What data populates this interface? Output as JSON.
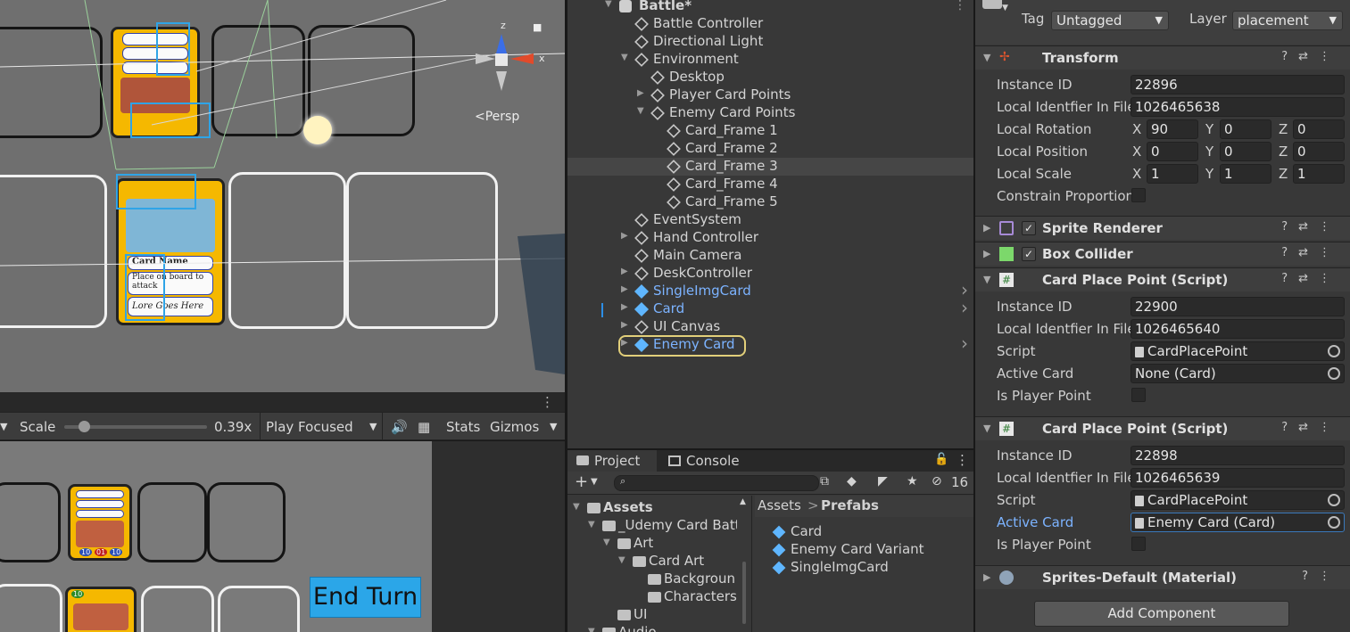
{
  "scene": {
    "persp_label": "<Persp",
    "gizmo_z": "z",
    "gizmo_x": "x",
    "card_labels": {
      "name": "Card Name",
      "desc_line1": "Place on board to",
      "desc_line2": "attack",
      "lore": "Lore Goes Here"
    }
  },
  "game_toolbar": {
    "scale_label": "Scale",
    "scale_value": 0.14,
    "scale_text": "0.39x",
    "play_mode": "Play Focused",
    "stats": "Stats",
    "gizmos": "Gizmos"
  },
  "game_view": {
    "end_turn": "End Turn",
    "card_numbers": [
      "10",
      "10",
      "01",
      "10"
    ]
  },
  "hierarchy": {
    "scene_name": "Battle*",
    "items": [
      {
        "label": "Battle Controller",
        "prefab": false
      },
      {
        "label": "Directional Light",
        "prefab": false
      },
      {
        "label": "Environment",
        "prefab": false
      },
      {
        "label": "Desktop",
        "prefab": false
      },
      {
        "label": "Player Card Points",
        "prefab": false
      },
      {
        "label": "Enemy Card Points",
        "prefab": false
      },
      {
        "label": "Card_Frame 1",
        "prefab": false
      },
      {
        "label": "Card_Frame 2",
        "prefab": false
      },
      {
        "label": "Card_Frame 3",
        "prefab": false
      },
      {
        "label": "Card_Frame 4",
        "prefab": false
      },
      {
        "label": "Card_Frame 5",
        "prefab": false
      },
      {
        "label": "EventSystem",
        "prefab": false
      },
      {
        "label": "Hand Controller",
        "prefab": false
      },
      {
        "label": "Main Camera",
        "prefab": false
      },
      {
        "label": "DeskController",
        "prefab": false
      },
      {
        "label": "SingleImgCard",
        "prefab": true
      },
      {
        "label": "Card",
        "prefab": true
      },
      {
        "label": "UI Canvas",
        "prefab": false
      },
      {
        "label": "Enemy Card",
        "prefab": true
      }
    ]
  },
  "project": {
    "tab_project": "Project",
    "tab_console": "Console",
    "hidden_count": "16",
    "tree": [
      "Assets",
      "_Udemy Card Battl",
      "Art",
      "Card Art",
      "Backgroun",
      "Characters",
      "UI",
      "Audio"
    ],
    "breadcrumb_root": "Assets",
    "breadcrumb_sep": ">",
    "breadcrumb_current": "Prefabs",
    "files": [
      "Card",
      "Enemy Card Variant",
      "SingleImgCard"
    ]
  },
  "inspector": {
    "tag_label": "Tag",
    "tag_value": "Untagged",
    "layer_label": "Layer",
    "layer_value": "placement",
    "transform": {
      "title": "Transform",
      "instance_id_label": "Instance ID",
      "instance_id": "22896",
      "local_id_label": "Local Identfier In File",
      "local_id": "1026465638",
      "rotation_label": "Local Rotation",
      "rotation": {
        "x": "90",
        "y": "0",
        "z": "0"
      },
      "position_label": "Local Position",
      "position": {
        "x": "0",
        "y": "0",
        "z": "0"
      },
      "scale_label": "Local Scale",
      "scale": {
        "x": "1",
        "y": "1",
        "z": "1"
      },
      "constrain_label": "Constrain Proportion",
      "axis_x": "X",
      "axis_y": "Y",
      "axis_z": "Z"
    },
    "sprite_renderer": "Sprite Renderer",
    "box_collider": "Box Collider",
    "cpp1": {
      "title": "Card Place Point (Script)",
      "instance_id_label": "Instance ID",
      "instance_id": "22900",
      "local_id_label": "Local Identfier In File",
      "local_id": "1026465640",
      "script_label": "Script",
      "script": "CardPlacePoint",
      "active_card_label": "Active Card",
      "active_card": "None (Card)",
      "is_player_label": "Is Player Point"
    },
    "cpp2": {
      "title": "Card Place Point (Script)",
      "instance_id_label": "Instance ID",
      "instance_id": "22898",
      "local_id_label": "Local Identfier In File",
      "local_id": "1026465639",
      "script_label": "Script",
      "script": "CardPlacePoint",
      "active_card_label": "Active Card",
      "active_card": "Enemy Card (Card)",
      "is_player_label": "Is Player Point"
    },
    "material": "Sprites-Default (Material)",
    "add_component": "Add Component"
  },
  "colors": {
    "prefab_blue": "#7cb3ff",
    "selection_outline": "#e2cf7a",
    "end_turn_bg": "#2ba6e8",
    "selection_blue": "#2fa4e7"
  }
}
